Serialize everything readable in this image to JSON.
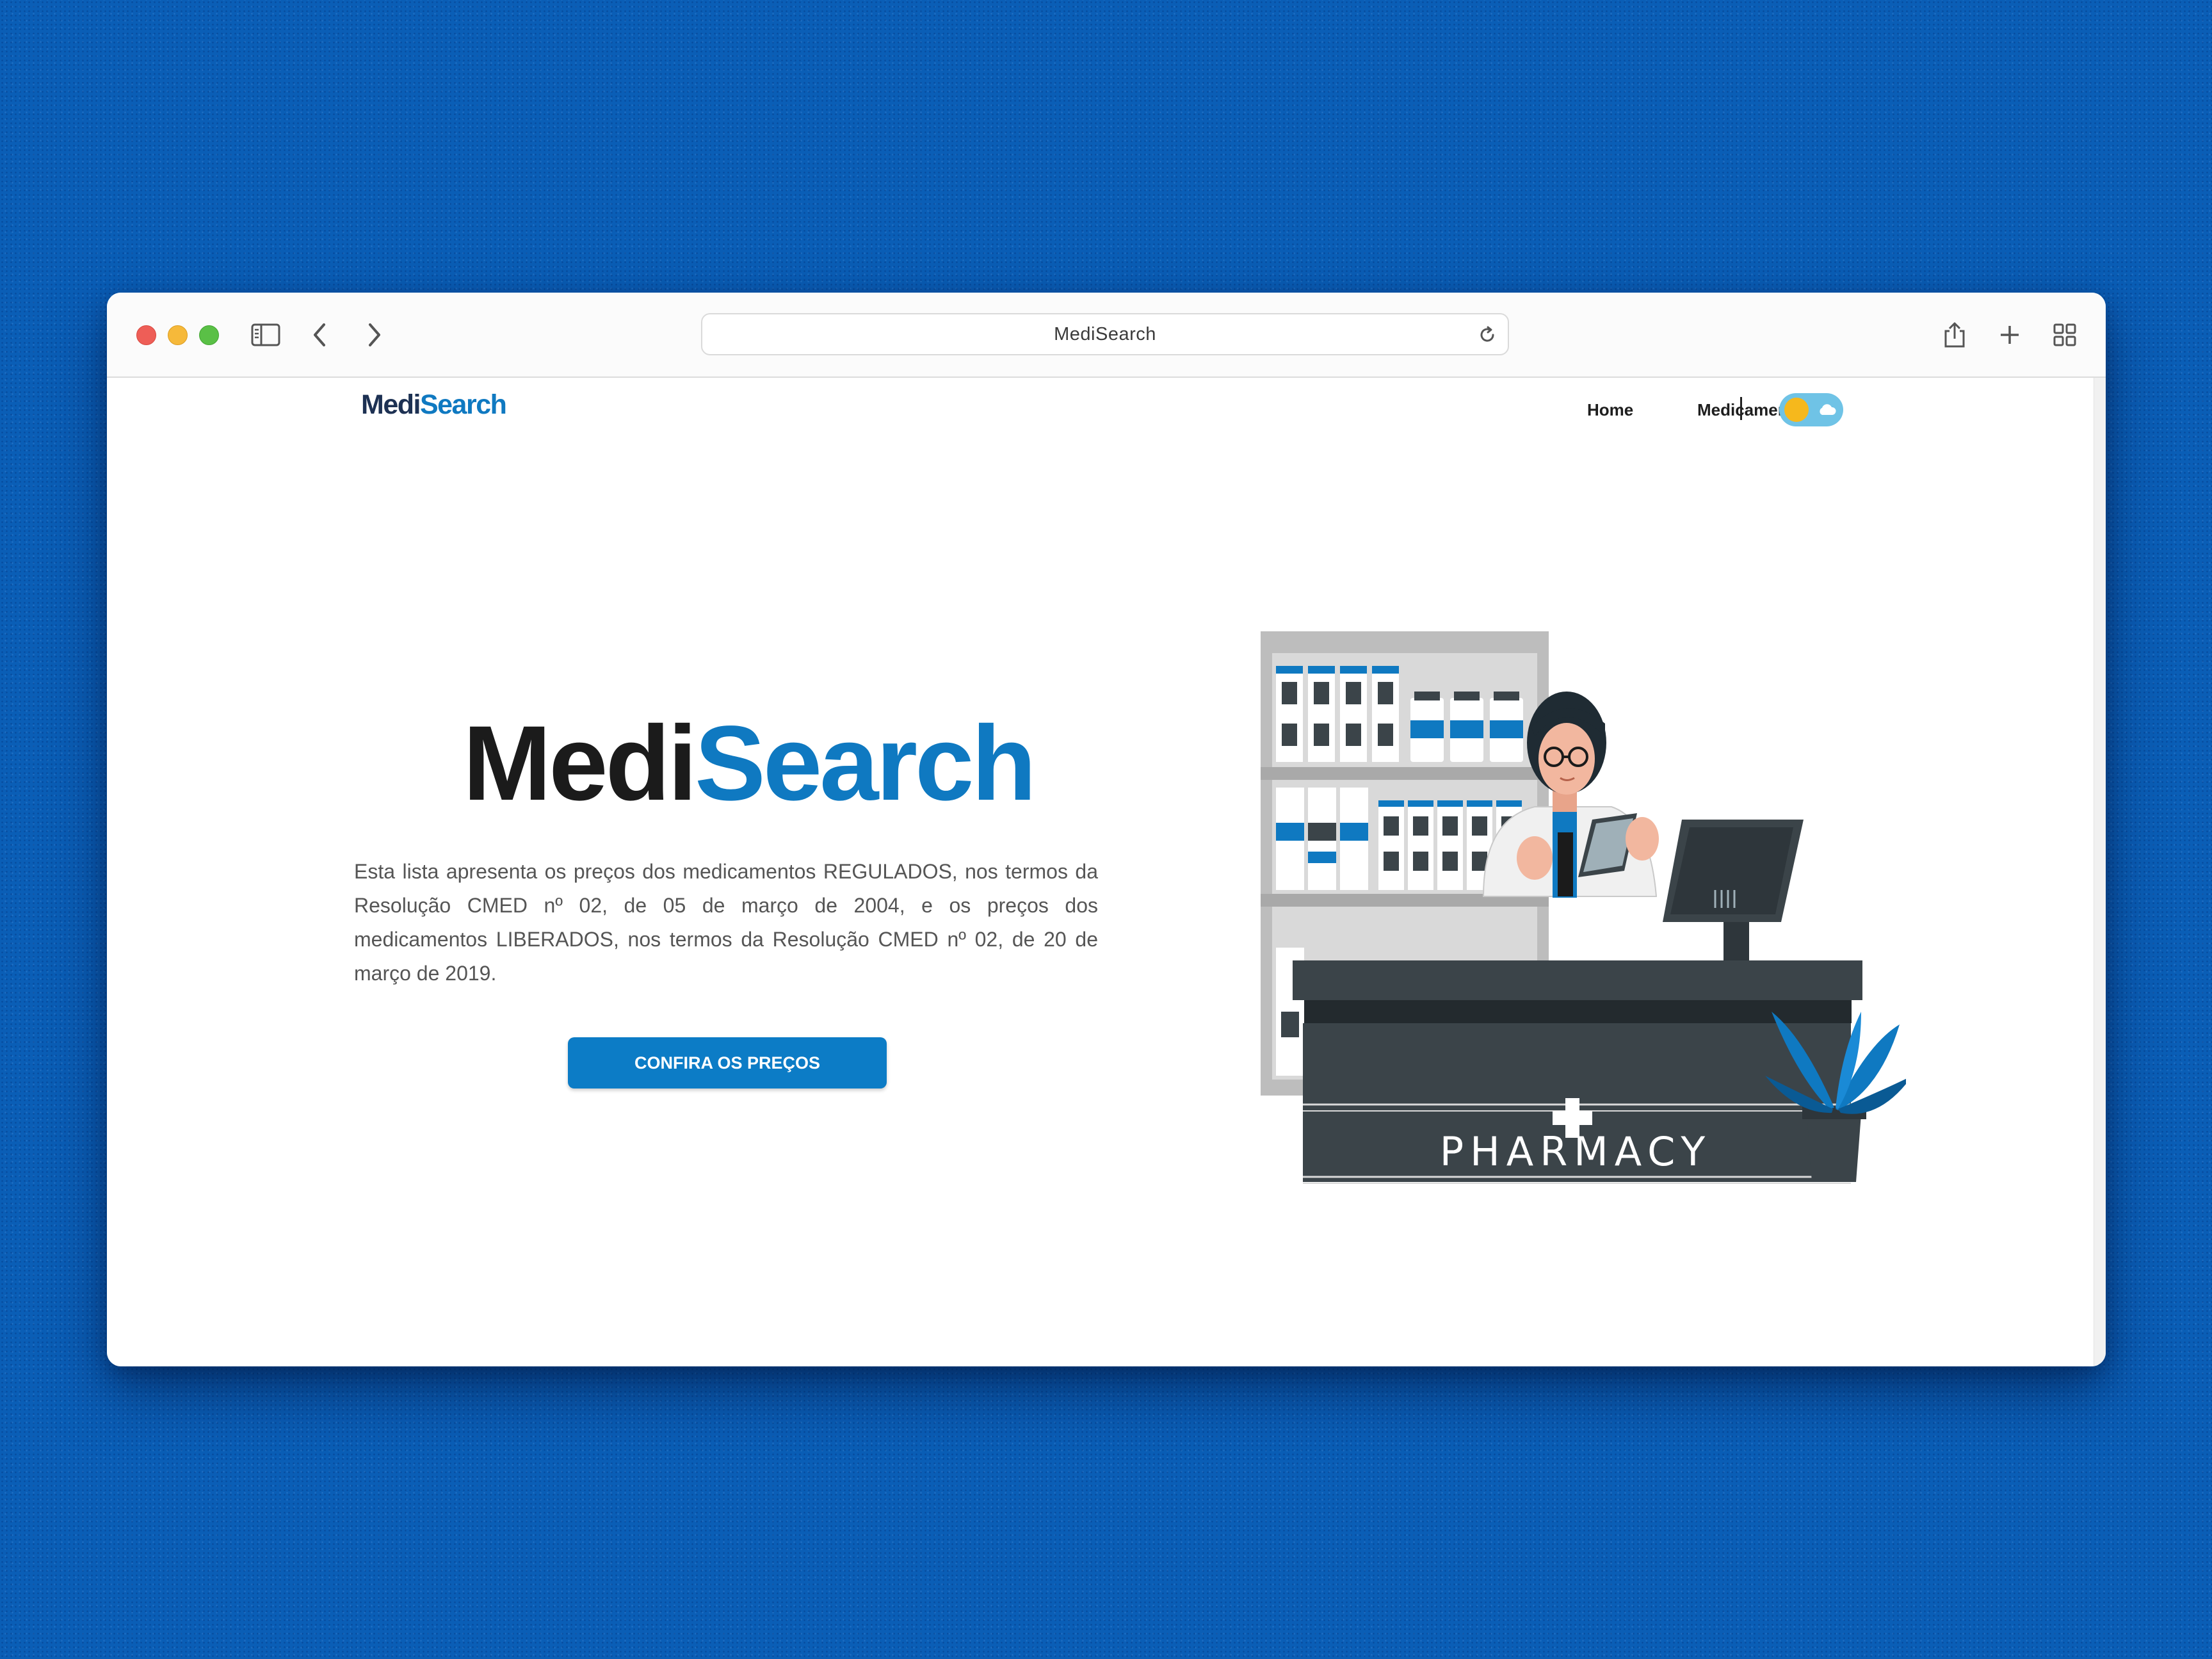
{
  "browser": {
    "address_text": "MediSearch",
    "icons": [
      "sidebar-icon",
      "back-icon",
      "forward-icon",
      "reload-icon",
      "share-icon",
      "new-tab-icon",
      "tab-overview-icon"
    ]
  },
  "site": {
    "logo_part1": "Medi",
    "logo_part2": "Search",
    "nav": {
      "home": "Home",
      "medicamentos": "Medicamentos"
    },
    "theme_toggle": {
      "state": "light",
      "icons": [
        "sun-icon",
        "cloud-icon"
      ]
    }
  },
  "hero": {
    "title_part1": "Medi",
    "title_part2": "Search",
    "description": "Esta lista apresenta os preços dos medicamentos REGULADOS, nos termos da Resolução CMED nº 02, de 05 de março de 2004, e os preços dos medicamentos LIBERADOS, nos termos da Resolução CMED nº 02, de 20 de março de 2019.",
    "cta_label": "CONFIRA OS PREÇOS"
  },
  "illustration": {
    "counter_sign": "PHARMACY"
  },
  "colors": {
    "brand_blue": "#0f79c1",
    "brand_dark": "#1d3153",
    "counter": "#3b4449",
    "background": "#0a5eb6"
  }
}
